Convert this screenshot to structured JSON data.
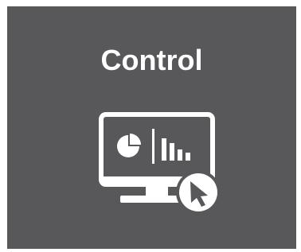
{
  "tile": {
    "title": "Control",
    "icon": "monitor-dashboard-cursor-icon",
    "background_color": "#58585a",
    "text_color": "#ffffff"
  }
}
